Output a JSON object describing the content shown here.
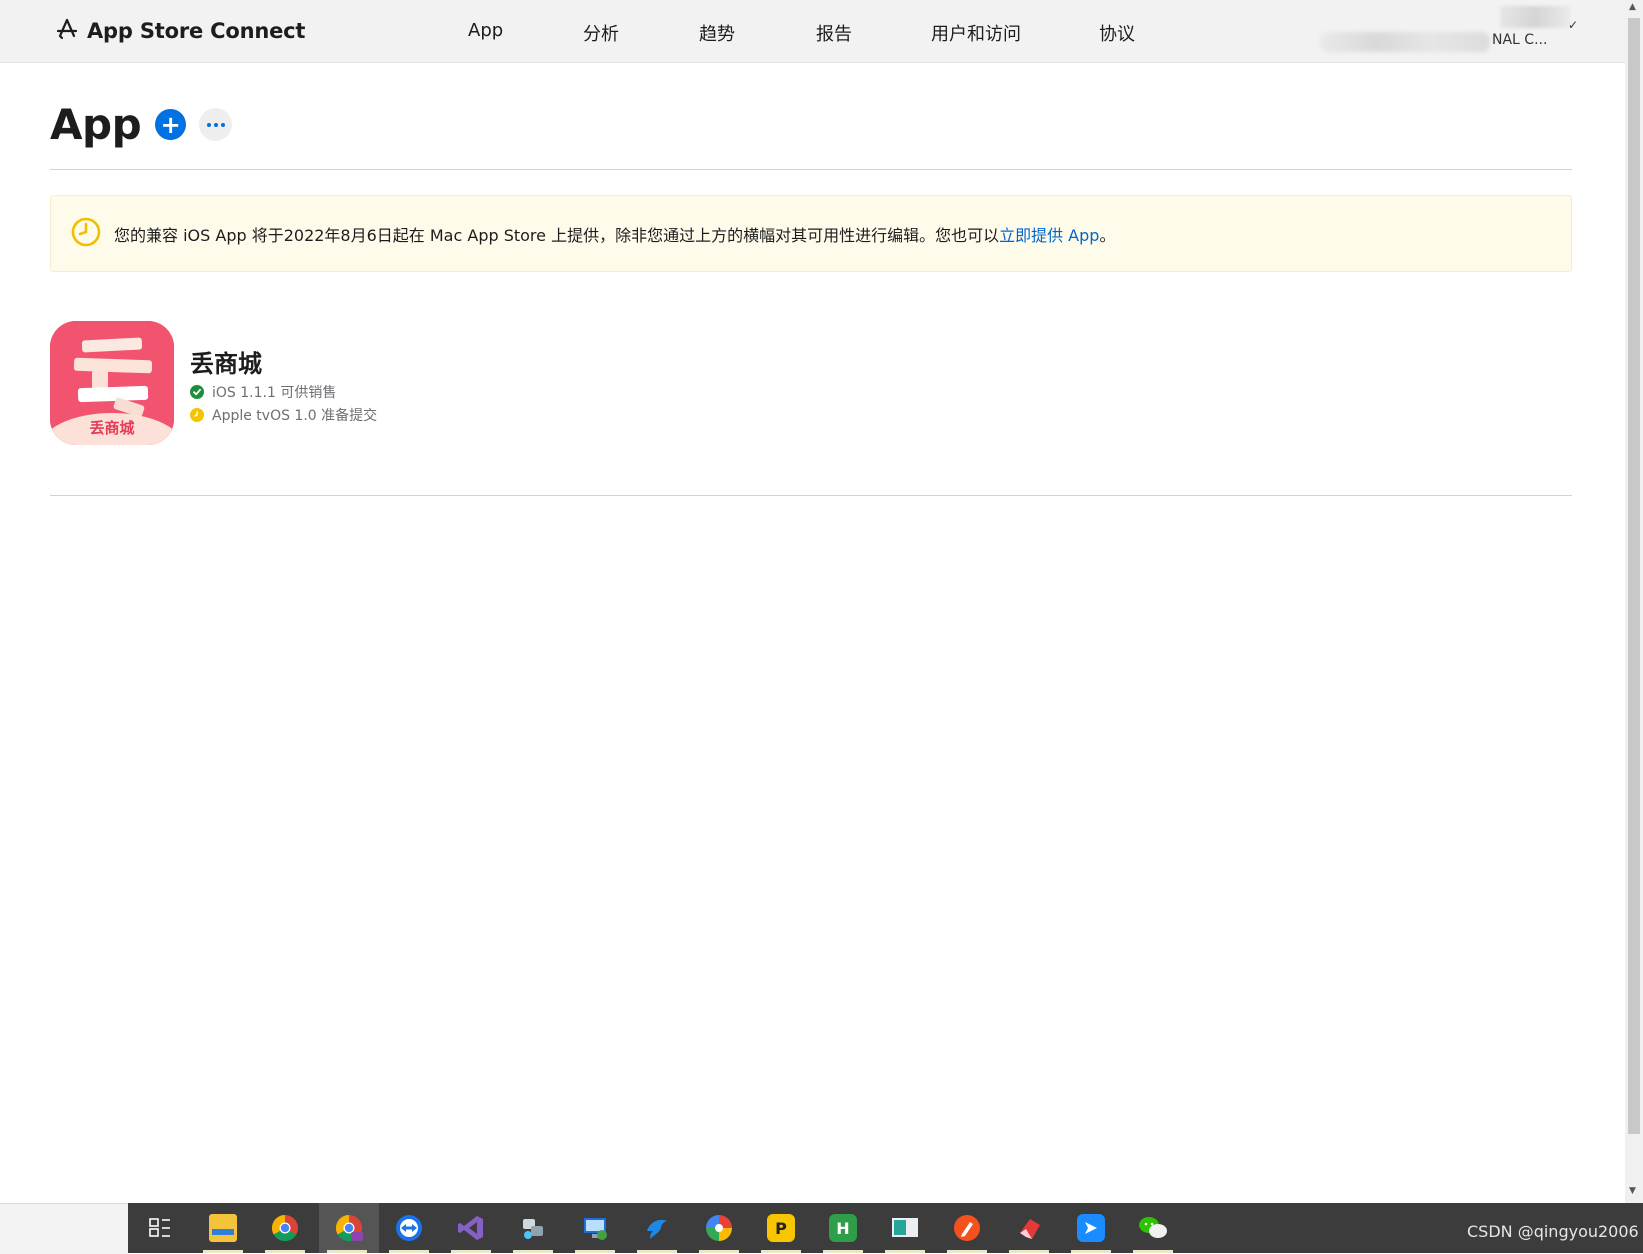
{
  "header": {
    "brand": "App Store Connect",
    "nav": [
      "App",
      "分析",
      "趋势",
      "报告",
      "用户和访问",
      "协议"
    ],
    "account_label": "NAL C...",
    "account_chevron": "✓"
  },
  "page": {
    "title": "App",
    "add_label": "+"
  },
  "notice": {
    "text": "您的兼容 iOS App 将于2022年8月6日起在 Mac App Store 上提供，除非您通过上方的横幅对其可用性进行编辑。您也可以",
    "link": "立即提供 App",
    "suffix": "。",
    "icon": "clock-icon"
  },
  "apps": [
    {
      "name": "丢商城",
      "icon_label": "丢商城",
      "icon_glyph": "丢",
      "statuses": [
        {
          "text": "iOS 1.1.1 可供销售",
          "state": "ready-for-sale",
          "color": "#1e8e3e"
        },
        {
          "text": "Apple tvOS 1.0 准备提交",
          "state": "prepare-for-submission",
          "color": "#f5c400"
        }
      ]
    }
  ],
  "taskbar": {
    "items": [
      "task-view-icon",
      "file-explorer-icon",
      "chrome-icon",
      "chrome-profile-icon",
      "teamviewer-icon",
      "visual-studio-icon",
      "network-tool-icon",
      "remote-desktop-icon",
      "dolphin-app-icon",
      "pinwheel-app-icon",
      "pad-app-icon",
      "hbuilder-icon",
      "display-app-icon",
      "pencil-app-icon",
      "eraser-app-icon",
      "feishu-icon",
      "wechat-icon"
    ],
    "hbuilder_letter": "H",
    "pad_letter": "P"
  },
  "watermark": "CSDN @qingyou2006",
  "colors": {
    "accent": "#0071e3",
    "link": "#0066cc",
    "notice_bg": "#fffbea",
    "icon_bg": "#f2536f"
  }
}
